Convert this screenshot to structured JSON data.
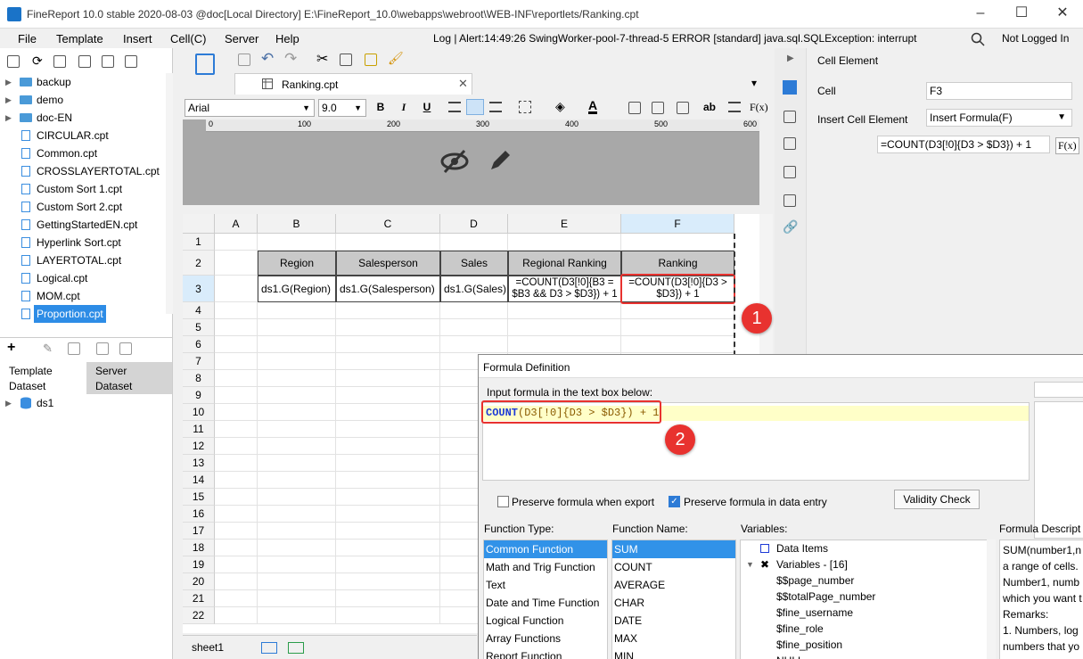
{
  "window": {
    "title": "FineReport 10.0 stable 2020-08-03 @doc[Local Directory]    E:\\FineReport_10.0\\webapps\\webroot\\WEB-INF\\reportlets/Ranking.cpt",
    "minimize": "–",
    "maximize": "☐",
    "close": "✕"
  },
  "menu": {
    "items": [
      "File",
      "Template",
      "Insert",
      "Cell(C)",
      "Server",
      "Help"
    ],
    "log": "Log | Alert:14:49:26 SwingWorker-pool-7-thread-5 ERROR [standard] java.sql.SQLException: interrupt",
    "login": "Not Logged In"
  },
  "tree": {
    "items": [
      {
        "label": "backup",
        "type": "folder"
      },
      {
        "label": "demo",
        "type": "folder"
      },
      {
        "label": "doc-EN",
        "type": "folder"
      },
      {
        "label": "CIRCULAR.cpt",
        "type": "file"
      },
      {
        "label": "Common.cpt",
        "type": "file"
      },
      {
        "label": "CROSSLAYERTOTAL.cpt",
        "type": "file"
      },
      {
        "label": "Custom Sort 1.cpt",
        "type": "file"
      },
      {
        "label": "Custom Sort 2.cpt",
        "type": "file"
      },
      {
        "label": "GettingStartedEN.cpt",
        "type": "file"
      },
      {
        "label": "Hyperlink Sort.cpt",
        "type": "file"
      },
      {
        "label": "LAYERTOTAL.cpt",
        "type": "file"
      },
      {
        "label": "Logical.cpt",
        "type": "file"
      },
      {
        "label": "MOM.cpt",
        "type": "file"
      },
      {
        "label": "Proportion.cpt",
        "type": "file",
        "selected": true
      }
    ]
  },
  "dataset": {
    "tab_template_1": "Template",
    "tab_template_2": "Dataset",
    "tab_server_1": "Server",
    "tab_server_2": "Dataset",
    "item": "ds1"
  },
  "editor": {
    "file_tab": "Ranking.cpt",
    "font": "Arial",
    "size": "9.0",
    "bold": "B",
    "italic": "I",
    "underline": "U",
    "fx": "F(x)",
    "abc": "ab",
    "ruler_ticks": [
      "0",
      "100",
      "200",
      "300",
      "400",
      "500",
      "600"
    ]
  },
  "grid": {
    "columns": [
      "A",
      "B",
      "C",
      "D",
      "E",
      "F"
    ],
    "rows": [
      "1",
      "2",
      "3",
      "4",
      "5",
      "6",
      "7",
      "8",
      "9",
      "10",
      "11",
      "12",
      "13",
      "14",
      "15",
      "16",
      "17",
      "18",
      "19",
      "20",
      "21",
      "22"
    ],
    "headers": [
      "Region",
      "Salesperson",
      "Sales",
      "Regional Ranking",
      "Ranking"
    ],
    "row3": [
      "ds1.G(Region)",
      "ds1.G(Salesperson)",
      "ds1.G(Sales)",
      "=COUNT(D3[!0]{B3 = $B3 && D3 > $D3}) + 1",
      "=COUNT(D3[!0]{D3 > $D3}) + 1"
    ],
    "sheet": "sheet1"
  },
  "right_panel": {
    "title": "Cell Element",
    "cell_label": "Cell",
    "cell_value": "F3",
    "insert_label": "Insert Cell Element",
    "insert_value": "Insert Formula(F)",
    "formula": "=COUNT(D3[!0]{D3 > $D3}) + 1",
    "fx": "F(x)"
  },
  "dialog": {
    "title": "Formula Definition",
    "instruction": "Input formula in the text box below:",
    "formula_fn": "COUNT",
    "formula_rest": "(D3[!0]{D3 > $D3}) + 1",
    "preserve_export": "Preserve formula when export",
    "preserve_entry": "Preserve formula in data entry",
    "validity_btn": "Validity Check",
    "function_type_label": "Function Type:",
    "function_name_label": "Function Name:",
    "variables_label": "Variables:",
    "description_label": "Formula Descript",
    "function_types": [
      "Common Function",
      "Math and Trig Function",
      "Text",
      "Date and Time Function",
      "Logical Function",
      "Array Functions",
      "Report Function"
    ],
    "function_names": [
      "SUM",
      "COUNT",
      "AVERAGE",
      "CHAR",
      "DATE",
      "MAX",
      "MIN"
    ],
    "variables": [
      {
        "label": "Data Items",
        "indent": 0
      },
      {
        "label": "Variables - [16]",
        "indent": 0
      },
      {
        "label": "$$page_number",
        "indent": 1
      },
      {
        "label": "$$totalPage_number",
        "indent": 1
      },
      {
        "label": "$fine_username",
        "indent": 1
      },
      {
        "label": "$fine_role",
        "indent": 1
      },
      {
        "label": "$fine_position",
        "indent": 1
      },
      {
        "label": "NULL",
        "indent": 1
      }
    ],
    "description_lines": [
      "SUM(number1,n",
      "a range of cells.",
      "Number1, numb",
      "which you want t",
      "Remarks:",
      "1. Numbers, log",
      "numbers that yo"
    ]
  },
  "badges": {
    "one": "1",
    "two": "2"
  }
}
